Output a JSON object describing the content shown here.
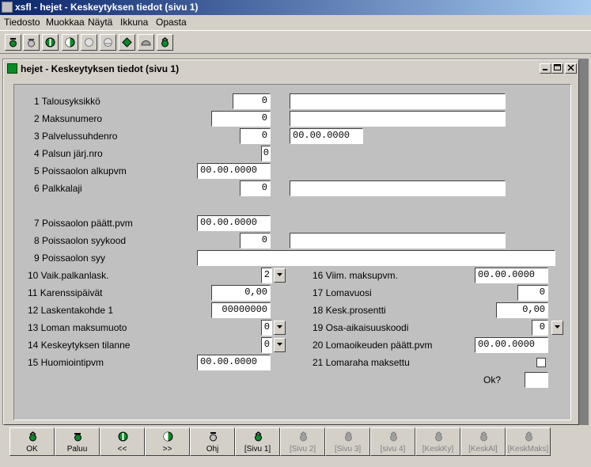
{
  "app": {
    "title": "xsfl - hejet - Keskeytyksen tiedot  (sivu 1)"
  },
  "menu": [
    "Tiedosto",
    "Muokkaa",
    "Näytä",
    "Ikkuna",
    "Opasta"
  ],
  "child": {
    "title": "hejet - Keskeytyksen tiedot  (sivu 1)"
  },
  "form": {
    "f1": {
      "label": "1 Talousyksikkö",
      "value": "0",
      "desc": ""
    },
    "f2": {
      "label": "2 Maksunumero",
      "value": "0",
      "desc": ""
    },
    "f3": {
      "label": "3 Palvelussuhdenro",
      "value": "0",
      "date": "00.00.0000"
    },
    "f4": {
      "label": "4 Palsun järj.nro",
      "value": "0"
    },
    "f5": {
      "label": "5 Poissaolon alkupvm",
      "value": "00.00.0000"
    },
    "f6": {
      "label": "6 Palkkalaji",
      "value": "0",
      "desc": ""
    },
    "f7": {
      "label": "7 Poissaolon päätt.pvm",
      "value": "00.00.0000"
    },
    "f8": {
      "label": "8 Poissaolon syykood",
      "value": "0",
      "desc": ""
    },
    "f9": {
      "label": "9 Poissaolon syy",
      "value": ""
    },
    "f10": {
      "label": "10 Vaik.palkanlask.",
      "value": "2"
    },
    "f11": {
      "label": "11 Karenssipäivät",
      "value": "0,00"
    },
    "f12": {
      "label": "12 Laskentakohde  1",
      "value": "00000000"
    },
    "f13": {
      "label": "13 Loman maksumuoto",
      "value": "0"
    },
    "f14": {
      "label": "14 Keskeytyksen tilanne",
      "value": "0"
    },
    "f15": {
      "label": "15 Huomiointipvm",
      "value": "00.00.0000"
    },
    "f16": {
      "label": "16 Viim. maksupvm.",
      "value": "00.00.0000"
    },
    "f17": {
      "label": "17 Lomavuosi",
      "value": "0"
    },
    "f18": {
      "label": "18 Kesk.prosentti",
      "value": "0,00"
    },
    "f19": {
      "label": "19 Osa-aikaisuuskoodi",
      "value": "0"
    },
    "f20": {
      "label": "20 Lomaoikeuden päätt.pvm",
      "value": "00.00.0000"
    },
    "f21": {
      "label": "21 Lomaraha maksettu",
      "checked": false
    },
    "ok": {
      "label": "Ok?",
      "value": ""
    }
  },
  "buttons": [
    {
      "label": "OK",
      "enabled": true
    },
    {
      "label": "Paluu",
      "enabled": true
    },
    {
      "label": "<<",
      "enabled": true
    },
    {
      "label": ">>",
      "enabled": true
    },
    {
      "label": "Ohj",
      "enabled": true
    },
    {
      "label": "[Sivu 1]",
      "enabled": true
    },
    {
      "label": "[Sivu 2]",
      "enabled": false
    },
    {
      "label": "[Sivu 3]",
      "enabled": false
    },
    {
      "label": "[sivu 4]",
      "enabled": false
    },
    {
      "label": "[KeskKy]",
      "enabled": false
    },
    {
      "label": "[KeskAl]",
      "enabled": false
    },
    {
      "label": "[KeskMaks]",
      "enabled": false
    }
  ],
  "colors": {
    "titlebar": "#0a246a",
    "face": "#d4d0c8",
    "panel": "#c0c0c0"
  }
}
